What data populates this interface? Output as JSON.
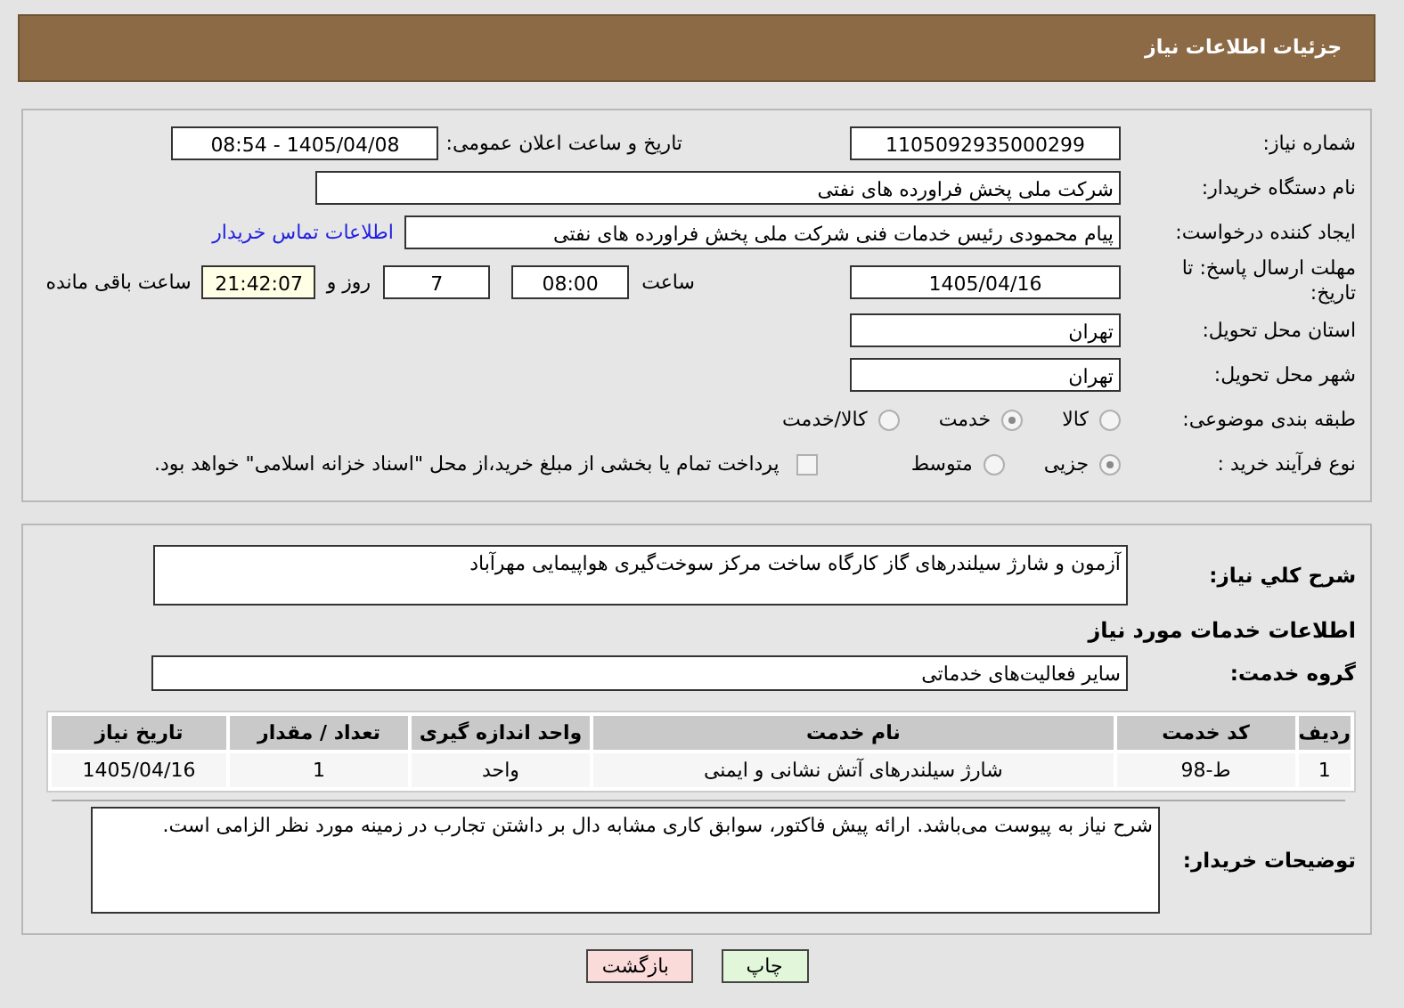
{
  "header": {
    "title": "جزئیات اطلاعات نیاز"
  },
  "need_number": {
    "label": "شماره نیاز:",
    "value": "1105092935000299"
  },
  "announce": {
    "label": "تاریخ و ساعت اعلان عمومی:",
    "value": "1405/04/08 - 08:54"
  },
  "buyer": {
    "label": "نام دستگاه خریدار:",
    "value": "شرکت ملی پخش فراورده های نفتی"
  },
  "creator": {
    "label": "ایجاد کننده درخواست:",
    "value": "پیام محمودی رئیس خدمات فنی  شرکت ملی پخش فراورده های نفتی",
    "link": "اطلاعات تماس خریدار"
  },
  "deadline": {
    "label": "مهلت ارسال پاسخ: تا تاریخ:",
    "date": "1405/04/16",
    "time_label": "ساعت",
    "time": "08:00",
    "days": "7",
    "days_label": "روز و",
    "remaining": "21:42:07",
    "remaining_label": "ساعت باقی مانده"
  },
  "province": {
    "label": "استان محل تحویل:",
    "value": "تهران"
  },
  "city": {
    "label": "شهر محل تحویل:",
    "value": "تهران"
  },
  "classification": {
    "label": "طبقه بندی موضوعی:",
    "options": [
      {
        "label": "کالا",
        "selected": false
      },
      {
        "label": "خدمت",
        "selected": true
      },
      {
        "label": "کالا/خدمت",
        "selected": false
      }
    ]
  },
  "purchase_type": {
    "label": "نوع فرآیند خرید :",
    "options": [
      {
        "label": "جزیی",
        "selected": true
      },
      {
        "label": "متوسط",
        "selected": false
      }
    ],
    "payment": {
      "label": "پرداخت تمام یا بخشی از مبلغ خرید،از محل \"اسناد خزانه اسلامی\" خواهد بود.",
      "checked": false
    }
  },
  "description": {
    "label": "شرح کلي نیاز:",
    "value": "آزمون و شارژ سیلندرهای گاز کارگاه ساخت مرکز سوخت‌گیری هواپیمایی مهرآباد"
  },
  "services_heading": "اطلاعات خدمات مورد نیاز",
  "service_group": {
    "label": "گروه خدمت:",
    "value": "سایر فعالیت‌های خدماتی"
  },
  "table": {
    "columns": [
      "ردیف",
      "کد خدمت",
      "نام خدمت",
      "واحد اندازه گیری",
      "تعداد / مقدار",
      "تاریخ نیاز"
    ],
    "rows": [
      [
        "1",
        "ط-98",
        "شارژ سیلندرهای آتش نشانی و ایمنی",
        "واحد",
        "1",
        "1405/04/16"
      ]
    ]
  },
  "buyer_notes": {
    "label": "توضیحات خریدار:",
    "value": "شرح نیاز به پیوست می‌باشد. ارائه پیش فاکتور، سوابق کاری مشابه دال بر داشتن تجارب در زمینه مورد نظر الزامی است."
  },
  "buttons": [
    {
      "label": "چاپ",
      "kind": "print"
    },
    {
      "label": "بازگشت",
      "kind": "back"
    }
  ]
}
